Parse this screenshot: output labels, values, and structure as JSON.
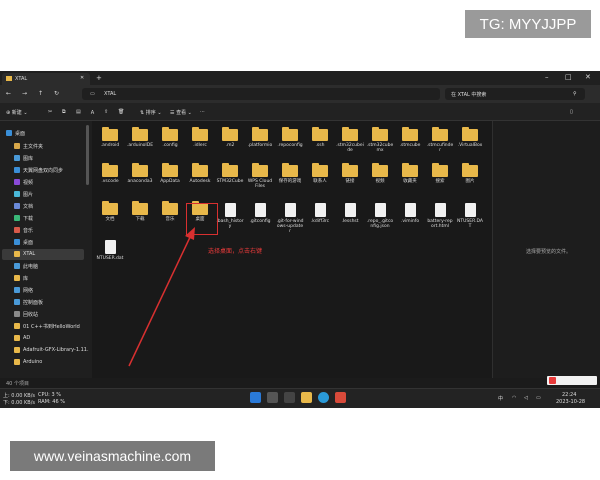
{
  "watermarks": {
    "tg": "TG: MYYJJPP",
    "site": "www.veinasmachine.com"
  },
  "tab": {
    "title": "XTAL"
  },
  "address": {
    "path": "XTAL",
    "search_placeholder": "在 XTAL 中搜索"
  },
  "toolbar": {
    "new_label": "新建",
    "sort_label": "排序",
    "view_label": "查看"
  },
  "sidebar": {
    "items": [
      "桌面",
      "主文件夹",
      "图库",
      "天翼网盘双向同步",
      "视频",
      "图片",
      "文档",
      "下载",
      "音乐",
      "桌面",
      "XTAL",
      "此电脑",
      "库",
      "网络",
      "控制面板",
      "回收站",
      "01 C++书到HelloWorld",
      "AD",
      "Adafruit-GFX-Library-1.11.",
      "Arduino"
    ]
  },
  "files": [
    {
      "name": ".android",
      "type": "folder"
    },
    {
      "name": ".arduinoIDE",
      "type": "folder"
    },
    {
      "name": ".config",
      "type": "folder"
    },
    {
      "name": ".idlerc",
      "type": "folder"
    },
    {
      "name": ".m2",
      "type": "folder"
    },
    {
      "name": ".platformio",
      "type": "folder"
    },
    {
      "name": ".repoconfig",
      "type": "folder"
    },
    {
      "name": ".ssh",
      "type": "folder"
    },
    {
      "name": ".stm32cubeide",
      "type": "folder"
    },
    {
      "name": ".stm32cubemx",
      "type": "folder"
    },
    {
      "name": ".stmcube",
      "type": "folder"
    },
    {
      "name": ".stmcufinder",
      "type": "folder"
    },
    {
      "name": ".VirtualBox",
      "type": "folder"
    },
    {
      "name": ".vscode",
      "type": "folder"
    },
    {
      "name": "anaconda3",
      "type": "folder"
    },
    {
      "name": "AppData",
      "type": "folder"
    },
    {
      "name": "Autodesk",
      "type": "folder"
    },
    {
      "name": "STM32Cube",
      "type": "folder"
    },
    {
      "name": "WPS Cloud Files",
      "type": "folder"
    },
    {
      "name": "保存的游戏",
      "type": "folder"
    },
    {
      "name": "联系人",
      "type": "folder"
    },
    {
      "name": "链接",
      "type": "folder"
    },
    {
      "name": "视频",
      "type": "folder"
    },
    {
      "name": "收藏夹",
      "type": "folder"
    },
    {
      "name": "搜索",
      "type": "folder"
    },
    {
      "name": "图片",
      "type": "folder"
    },
    {
      "name": "文档",
      "type": "folder"
    },
    {
      "name": "下载",
      "type": "folder"
    },
    {
      "name": "音乐",
      "type": "folder"
    },
    {
      "name": "桌面",
      "type": "folder"
    },
    {
      "name": ".bash_history",
      "type": "doc"
    },
    {
      "name": ".gitconfig",
      "type": "doc"
    },
    {
      "name": ".git-for-windows-updater",
      "type": "doc"
    },
    {
      "name": ".kdiff3rc",
      "type": "doc"
    },
    {
      "name": ".lesshst",
      "type": "doc"
    },
    {
      "name": ".repo_.gitconfig.json",
      "type": "doc"
    },
    {
      "name": ".viminfo",
      "type": "doc"
    },
    {
      "name": "battery-report.html",
      "type": "doc"
    },
    {
      "name": "NTUSER.DAT",
      "type": "doc"
    },
    {
      "name": "NTUSER.dat",
      "type": "doc"
    }
  ],
  "annotation": {
    "text": "选择桌面，点击右键"
  },
  "preview": {
    "text": "选择要预览的文件。"
  },
  "status": {
    "count": "40 个项目"
  },
  "taskbar": {
    "net_up": "上: 0.00 KB/s",
    "net_down": "下: 0.00 KB/s",
    "cpu": "CPU: 3 %",
    "ram": "RAM: 46 %",
    "lang": "中",
    "time": "22:24",
    "date": "2023-10-28"
  }
}
